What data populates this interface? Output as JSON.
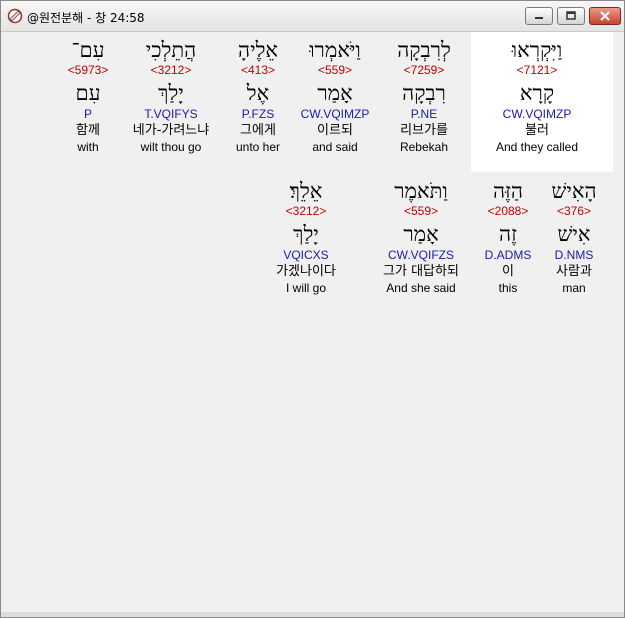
{
  "window": {
    "title": "@원전분해 - 창 24:58"
  },
  "rows": [
    {
      "words": [
        {
          "hebrew": "וַיִּקְרְאוּ",
          "strong": "<7121>",
          "lemma": "קָרָא",
          "morph": "CW.VQIMZP",
          "korean": "불러",
          "english": "And they called",
          "selected": true
        },
        {
          "hebrew": "לְרִבְקָה",
          "strong": "<7259>",
          "lemma": "רִבְקָה",
          "morph": "P.NE",
          "korean": "리브가를",
          "english": "Rebekah",
          "selected": false
        },
        {
          "hebrew": "וַיֹּאמְרוּ",
          "strong": "<559>",
          "lemma": "אָמַר",
          "morph": "CW.VQIMZP",
          "korean": "이르되",
          "english": "and said",
          "selected": false
        },
        {
          "hebrew": "אֵלֶיהָ",
          "strong": "<413>",
          "lemma": "אֶל",
          "morph": "P.FZS",
          "korean": "그에게",
          "english": "unto her",
          "selected": false
        },
        {
          "hebrew": "הֲתֵלְכִי",
          "strong": "<3212>",
          "lemma": "יָלַךְ",
          "morph": "T.VQIFYS",
          "korean": "네가-가려느냐",
          "english": "wilt thou go",
          "selected": false
        },
        {
          "hebrew": "עִם־",
          "strong": "<5973>",
          "lemma": "עִם",
          "morph": "P",
          "korean": "함께",
          "english": "with",
          "selected": false
        }
      ]
    },
    {
      "words": [
        {
          "hebrew": "הָאִישׁ",
          "strong": "<376>",
          "lemma": "אִישׁ",
          "morph": "D.NMS",
          "korean": "사람과",
          "english": "man",
          "selected": false
        },
        {
          "hebrew": "הַזֶּה",
          "strong": "<2088>",
          "lemma": "זֶה",
          "morph": "D.ADMS",
          "korean": "이",
          "english": "this",
          "selected": false
        },
        {
          "hebrew": "וַתֹּאמֶר",
          "strong": "<559>",
          "lemma": "אָמַר",
          "morph": "CW.VQIFZS",
          "korean": "그가 대답하되",
          "english": "And she said",
          "selected": false
        },
        {
          "hebrew": "אֵלֵךְ׃",
          "strong": "<3212>",
          "lemma": "יָלַךְ",
          "morph": "VQICXS",
          "korean": "가겠나이다",
          "english": "I will go",
          "selected": false
        }
      ]
    }
  ]
}
